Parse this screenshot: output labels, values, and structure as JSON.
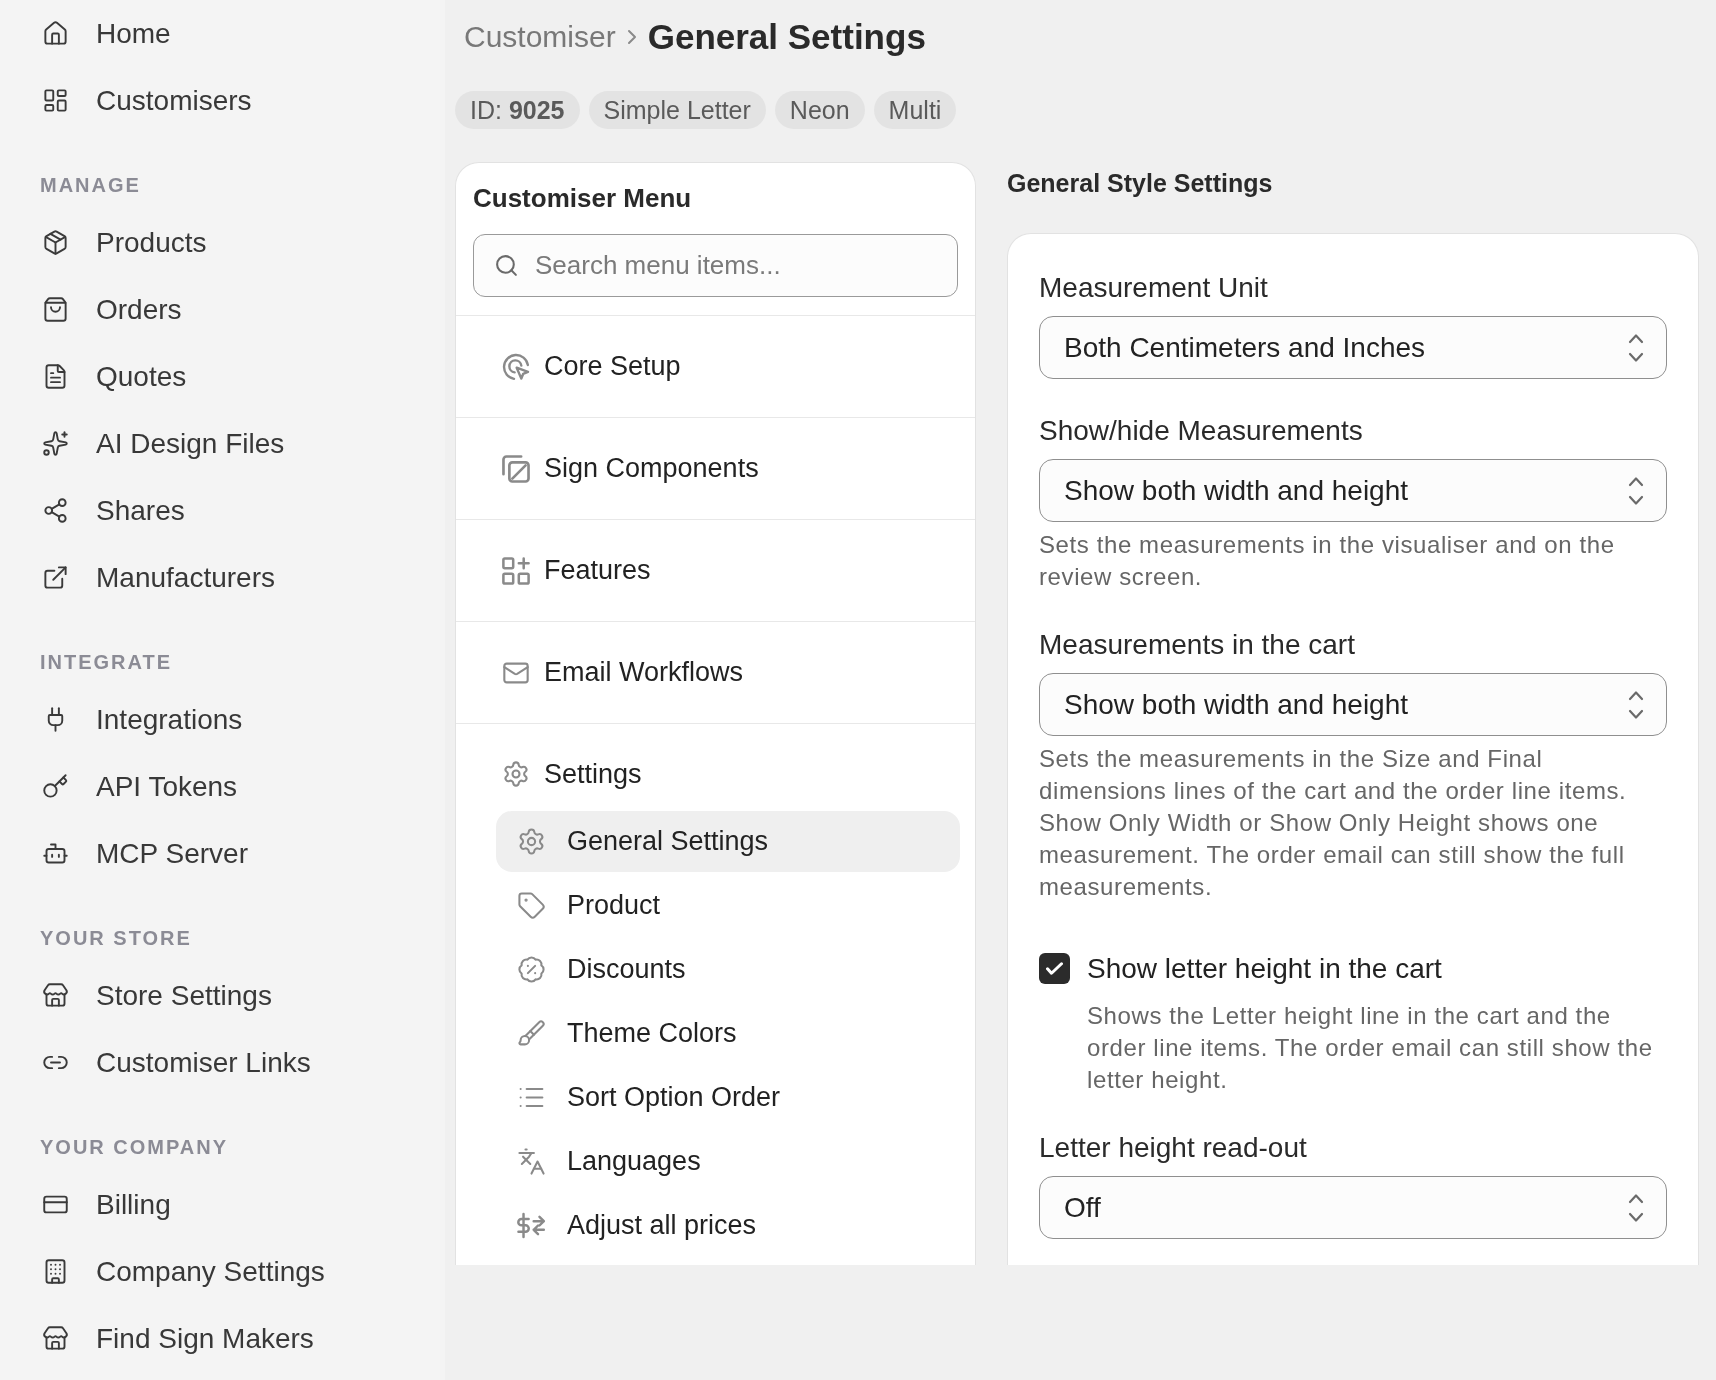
{
  "sidebar": {
    "items": [
      {
        "label": "Home"
      },
      {
        "label": "Customisers"
      }
    ],
    "sections": [
      {
        "heading": "MANAGE",
        "items": [
          {
            "label": "Products"
          },
          {
            "label": "Orders"
          },
          {
            "label": "Quotes"
          },
          {
            "label": "AI Design Files"
          },
          {
            "label": "Shares"
          },
          {
            "label": "Manufacturers"
          }
        ]
      },
      {
        "heading": "INTEGRATE",
        "items": [
          {
            "label": "Integrations"
          },
          {
            "label": "API Tokens"
          },
          {
            "label": "MCP Server"
          }
        ]
      },
      {
        "heading": "YOUR STORE",
        "items": [
          {
            "label": "Store Settings"
          },
          {
            "label": "Customiser Links"
          }
        ]
      },
      {
        "heading": "YOUR COMPANY",
        "items": [
          {
            "label": "Billing"
          },
          {
            "label": "Company Settings"
          },
          {
            "label": "Find Sign Makers"
          }
        ]
      }
    ]
  },
  "breadcrumb": {
    "parent": "Customiser",
    "current": "General Settings"
  },
  "tags": [
    "ID: **9025**",
    "Simple Letter",
    "Neon",
    "Multi"
  ],
  "menu": {
    "title": "Customiser Menu",
    "search": {
      "placeholder": "Search menu items..."
    },
    "sections": [
      {
        "label": "Core Setup"
      },
      {
        "label": "Sign Components"
      },
      {
        "label": "Features"
      },
      {
        "label": "Email Workflows"
      },
      {
        "label": "Settings",
        "children": [
          {
            "label": "General Settings",
            "selected": true
          },
          {
            "label": "Product",
            "selected": false
          },
          {
            "label": "Discounts",
            "selected": false
          },
          {
            "label": "Theme Colors",
            "selected": false
          },
          {
            "label": "Sort Option Order",
            "selected": false
          },
          {
            "label": "Languages",
            "selected": false
          },
          {
            "label": "Adjust all prices",
            "selected": false
          }
        ]
      }
    ]
  },
  "settings": {
    "title": "General Style Settings",
    "fields": [
      {
        "kind": "select",
        "label": "Measurement Unit",
        "value": "Both Centimeters and Inches"
      },
      {
        "kind": "select",
        "label": "Show/hide Measurements",
        "value": "Show both width and height",
        "help": "Sets the measurements in the visualiser and on the review screen."
      },
      {
        "kind": "select",
        "label": "Measurements in the cart",
        "value": "Show both width and height",
        "help": "Sets the measurements in the Size and Final dimensions lines of the cart and the order line items. Show Only Width or Show Only Height shows one measurement. The order email can still show the full measurements."
      },
      {
        "kind": "checkbox",
        "label": "Show letter height in the cart",
        "checked": true,
        "help": "Shows the Letter height line in the cart and the order line items. The order email can still show the letter height."
      },
      {
        "kind": "select",
        "label": "Letter height read-out",
        "value": "Off"
      }
    ]
  }
}
